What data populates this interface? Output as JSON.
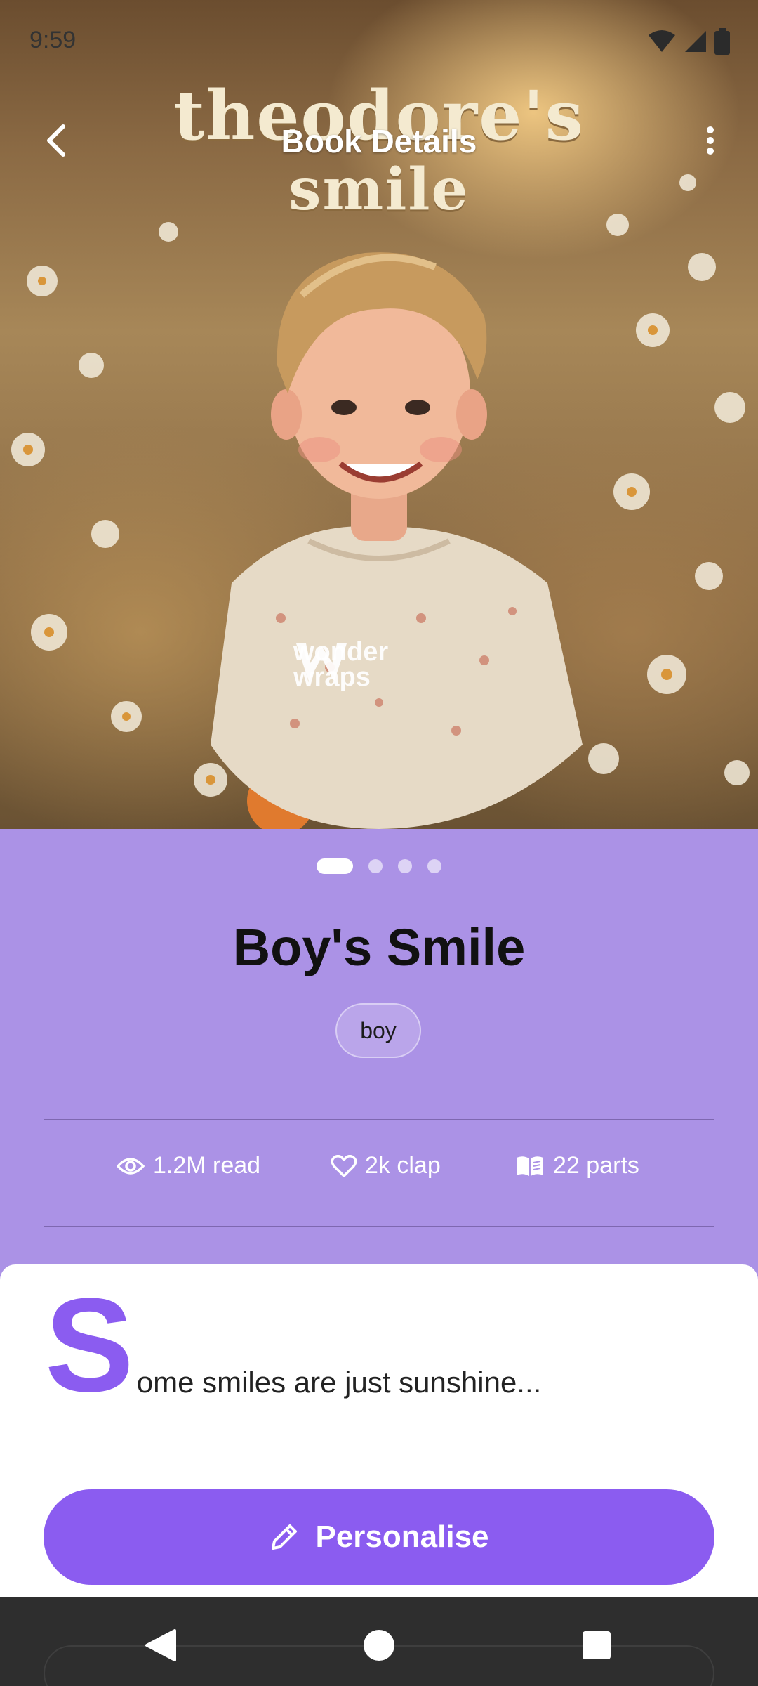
{
  "status_bar": {
    "time": "9:59",
    "icons": [
      "wifi-icon",
      "signal-icon",
      "battery-icon"
    ]
  },
  "app_bar": {
    "title": "Book Details",
    "back_icon": "arrow-back-icon",
    "more_icon": "more-vert-icon"
  },
  "cover": {
    "title_line1": "theodore's",
    "title_line2": "smile",
    "watermark_line1": "wonder",
    "watermark_line2": "wraps"
  },
  "carousel": {
    "page_count": 4,
    "active_index": 0
  },
  "book": {
    "title": "Boy's Smile",
    "tag": "boy"
  },
  "stats": {
    "reads": "1.2M read",
    "claps": "2k clap",
    "parts": "22 parts"
  },
  "excerpt": {
    "drop_cap": "S",
    "rest": "ome smiles are just sunshine..."
  },
  "actions": {
    "personalise_label": "Personalise",
    "personalise_icon": "pencil-icon"
  },
  "nav": {
    "icons": [
      "nav-back-icon",
      "nav-home-icon",
      "nav-recents-icon"
    ]
  },
  "colors": {
    "panel_background": "#ab92e6",
    "accent": "#8b5cf0",
    "nav_bar": "#2e2e2e"
  }
}
